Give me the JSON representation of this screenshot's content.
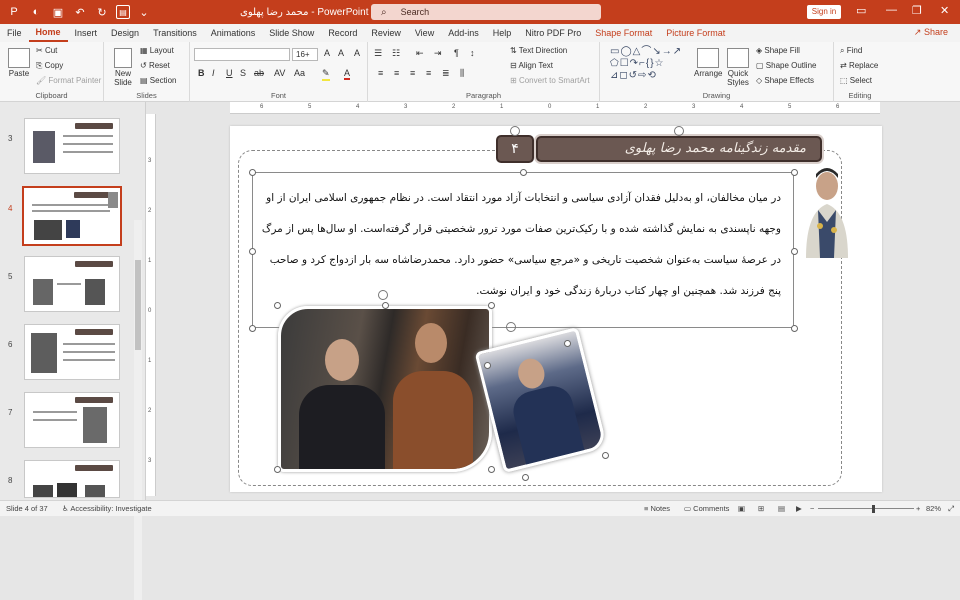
{
  "window": {
    "title": "محمد رضا پهلوی - PowerPoint",
    "search_placeholder": "Search",
    "signin": "Sign in",
    "share": "Share"
  },
  "menu": {
    "items": [
      "File",
      "Home",
      "Insert",
      "Design",
      "Transitions",
      "Animations",
      "Slide Show",
      "Record",
      "Review",
      "View",
      "Add-ins",
      "Help",
      "Nitro PDF Pro"
    ],
    "active": "Home",
    "contextual": [
      "Shape Format",
      "Picture Format"
    ]
  },
  "ribbon": {
    "clipboard": {
      "paste": "Paste",
      "cut": "Cut",
      "copy": "Copy",
      "format_painter": "Format Painter",
      "label": "Clipboard"
    },
    "slides": {
      "new_slide": "New Slide",
      "layout": "Layout",
      "reset": "Reset",
      "section": "Section",
      "label": "Slides"
    },
    "font": {
      "size": "16+",
      "label": "Font"
    },
    "paragraph": {
      "text_direction": "Text Direction",
      "align_text": "Align Text",
      "smartart": "Convert to SmartArt",
      "label": "Paragraph"
    },
    "drawing": {
      "arrange": "Arrange",
      "quick_styles": "Quick Styles",
      "shape_fill": "Shape Fill",
      "shape_outline": "Shape Outline",
      "shape_effects": "Shape Effects",
      "label": "Drawing"
    },
    "editing": {
      "find": "Find",
      "replace": "Replace",
      "select": "Select",
      "label": "Editing"
    }
  },
  "ruler": {
    "top": [
      "6",
      "5",
      "4",
      "3",
      "2",
      "1",
      "0",
      "1",
      "2",
      "3",
      "4",
      "5",
      "6"
    ],
    "left": [
      "3",
      "2",
      "1",
      "0",
      "1",
      "2",
      "3"
    ]
  },
  "slides_panel": {
    "numbers": [
      "3",
      "4",
      "5",
      "6",
      "7",
      "8"
    ],
    "selected": "4"
  },
  "slide": {
    "badge": "۴",
    "banner_title": "مقدمه زندگینامه محمد رضا پهلوی",
    "paragraph": "در میان مخالفان، او به‌دلیل فقدان آزادی سیاسی و انتخابات آزاد مورد انتقاد است. در نظام جمهوری اسلامی ایران از او وجهه ناپسندی به نمایش گذاشته شده و با رکیک‌ترین صفات مورد ترور شخصیتی قرار گرفته‌است. او سال‌ها پس از مرگ در عرصهٔ سیاست به‌عنوان شخصیت تاریخی و «مرجع سیاسی» حضور دارد. محمدرضاشاه سه بار ازدواج کرد و صاحب پنج فرزند شد. همچنین او چهار کتاب دربارهٔ زندگی خود و ایران نوشت."
  },
  "status": {
    "slide_of": "Slide 4 of 37",
    "accessibility": "Accessibility: Investigate",
    "notes": "Notes",
    "comments": "Comments",
    "zoom": "82%"
  },
  "colors": {
    "accent": "#c43e1c",
    "banner": "#6b5852"
  }
}
